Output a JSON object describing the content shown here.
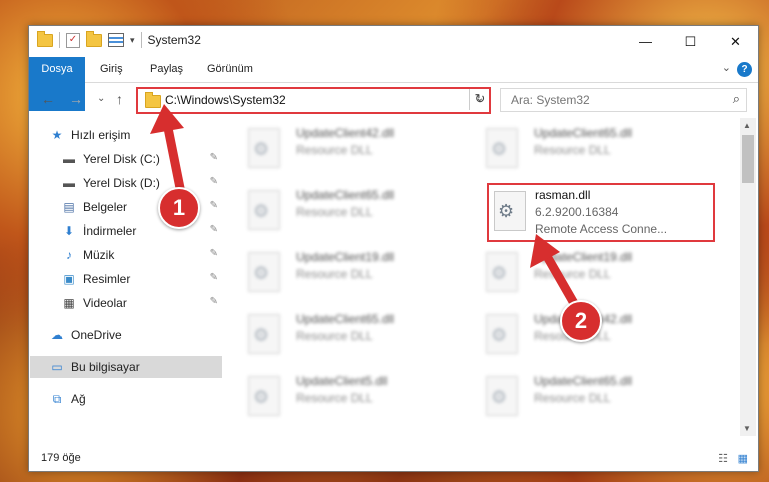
{
  "window": {
    "title": "System32",
    "caption": {
      "minimize": "—",
      "maximize": "☐",
      "close": "✕"
    }
  },
  "ribbon": {
    "tabs": [
      "Dosya",
      "Giriş",
      "Paylaş",
      "Görünüm"
    ],
    "collapse": "⌄",
    "help": "?"
  },
  "nav": {
    "back": "←",
    "forward": "→",
    "recent": "⌄",
    "up": "↑",
    "address": "C:\\Windows\\System32",
    "address_dropdown": "⌄",
    "refresh": "↻",
    "search_placeholder": "Ara: System32",
    "search_icon": "⌕"
  },
  "sidebar": {
    "items": [
      {
        "label": "Hızlı erişim",
        "icon": "star-icon",
        "glyph": "★",
        "pinned": false
      },
      {
        "label": "Yerel Disk (C:)",
        "icon": "drive-icon",
        "glyph": "▬",
        "pinned": true
      },
      {
        "label": "Yerel Disk (D:)",
        "icon": "drive-icon",
        "glyph": "▬",
        "pinned": true
      },
      {
        "label": "Belgeler",
        "icon": "documents-icon",
        "glyph": "▤",
        "pinned": true
      },
      {
        "label": "İndirmeler",
        "icon": "download-icon",
        "glyph": "⬇",
        "pinned": true
      },
      {
        "label": "Müzik",
        "icon": "music-icon",
        "glyph": "♪",
        "pinned": true
      },
      {
        "label": "Resimler",
        "icon": "pictures-icon",
        "glyph": "▣",
        "pinned": true
      },
      {
        "label": "Videolar",
        "icon": "video-icon",
        "glyph": "▦",
        "pinned": true
      },
      {
        "label": "OneDrive",
        "icon": "cloud-icon",
        "glyph": "☁",
        "pinned": false
      },
      {
        "label": "Bu bilgisayar",
        "icon": "computer-icon",
        "glyph": "▭",
        "pinned": false
      },
      {
        "label": "Ağ",
        "icon": "network-icon",
        "glyph": "⧉",
        "pinned": false
      }
    ],
    "pin_glyph": "📌"
  },
  "files": [
    {
      "name": "UpdateClient42.dll",
      "type": "Resource DLL"
    },
    {
      "name": "UpdateClient65.dll",
      "type": "Resource DLL"
    },
    {
      "name": "UpdateClient65.dll",
      "type": "Resource DLL"
    },
    {
      "name": "rasman.dll",
      "version": "6.2.9200.16384",
      "description": "Remote Access Conne..."
    },
    {
      "name": "UpdateClient19.dll",
      "type": "Resource DLL"
    },
    {
      "name": "UpdateClient19.dll",
      "type": "Resource DLL"
    },
    {
      "name": "UpdateClient65.dll",
      "type": "Resource DLL"
    },
    {
      "name": "UpdateClient42.dll",
      "type": "Resource DLL"
    },
    {
      "name": "UpdateClient5.dll",
      "type": "Resource DLL"
    },
    {
      "name": "UpdateClient65.dll",
      "type": "Resource DLL"
    }
  ],
  "status": {
    "count": "179 öğe"
  },
  "annotations": {
    "step1": "1",
    "step2": "2"
  },
  "colors": {
    "accent": "#1979ca",
    "highlight": "#e0393e",
    "badge": "#d72e2e"
  }
}
